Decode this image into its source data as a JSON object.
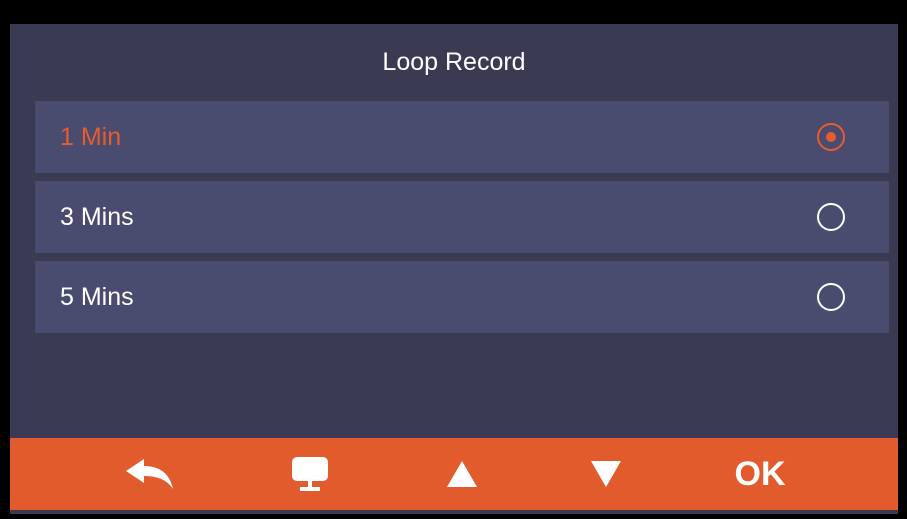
{
  "menu": {
    "title": "Loop Record",
    "options": [
      {
        "label": "1 Min",
        "selected": true
      },
      {
        "label": "3 Mins",
        "selected": false
      },
      {
        "label": "5 Mins",
        "selected": false
      }
    ]
  },
  "toolbar": {
    "back_icon": "back-arrow-icon",
    "mode_icon": "monitor-icon",
    "up_icon": "triangle-up-icon",
    "down_icon": "triangle-down-icon",
    "ok_label": "OK"
  },
  "colors": {
    "background": "#3a3a52",
    "option_bg": "#494b6f",
    "accent": "#e25b2d",
    "text": "#ffffff"
  }
}
